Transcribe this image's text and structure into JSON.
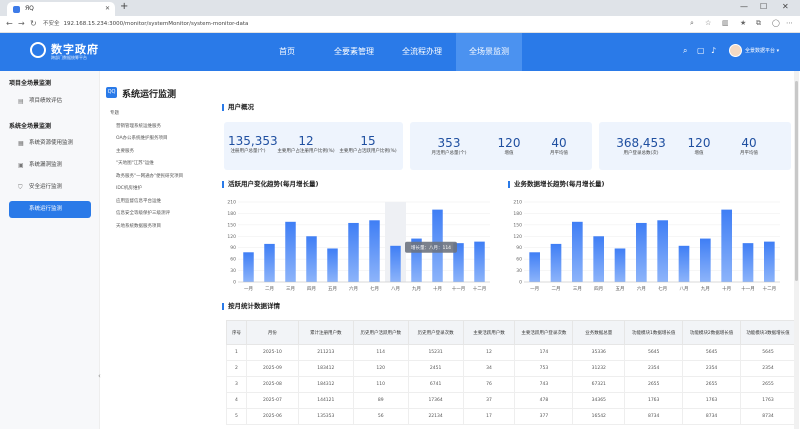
{
  "browser": {
    "tab_title": "ЯQ",
    "url_warning": "不安全",
    "url": "192.168.15.234:3000/monitor/systemMonitor/system-monitor-data"
  },
  "header": {
    "logo_title": "数字政府",
    "logo_sub": "跨部门数据统筹平台",
    "menu": [
      "首页",
      "全要素管理",
      "全流程办理",
      "全场景监测"
    ],
    "active_menu": 3,
    "user": "全景数据平台 ▾"
  },
  "sidebar": {
    "groups": [
      {
        "title": "项目全场景监测",
        "items": [
          {
            "label": "项目绩效评估",
            "icon": "doc-icon"
          }
        ]
      },
      {
        "title": "系统全场景监测",
        "items": [
          {
            "label": "系统资源使用监测",
            "icon": "server-icon"
          },
          {
            "label": "系统漏洞监测",
            "icon": "bug-icon"
          },
          {
            "label": "安全运行监测",
            "icon": "shield-icon"
          },
          {
            "label": "系统运行监测",
            "icon": "monitor-icon",
            "active": true
          }
        ]
      }
    ]
  },
  "page": {
    "title": "系统运行监测",
    "title_icon": "QQ"
  },
  "tree": {
    "items": [
      "专题",
      "营销管理系统运维服务",
      "OA办公系统维护服务项目",
      "主要服务",
      "\"天地图\"江苏\"运维",
      "政务服务\"一网通办\"便民研究项目",
      "IDC机房维护",
      "应用监督信息平台运维",
      "信息安全等级保护三级测评",
      "天地系统数据服务项目"
    ]
  },
  "overview": {
    "title": "用户概况",
    "cards": [
      [
        {
          "v": "135,353",
          "l": "注册用户总量(个)"
        },
        {
          "v": "12",
          "l": "主要用户占注册用户比例(%)"
        },
        {
          "v": "15",
          "l": "主要用户占活跃用户比例(%)"
        }
      ],
      [
        {
          "v": "353",
          "l": "月活用户总量(个)"
        },
        {
          "v": "120",
          "l": "增值"
        },
        {
          "v": "40",
          "l": "月平均值"
        }
      ],
      [
        {
          "v": "368,453",
          "l": "用户登录总数(次)"
        },
        {
          "v": "120",
          "l": "增值"
        },
        {
          "v": "40",
          "l": "月平均值"
        }
      ]
    ]
  },
  "chart_data": [
    {
      "type": "bar",
      "title": "活跃用户变化趋势(每月增长量)",
      "categories": [
        "一月",
        "二月",
        "三月",
        "四月",
        "五月",
        "六月",
        "七月",
        "八月",
        "九月",
        "十月",
        "十一月",
        "十二月"
      ],
      "values": [
        78,
        100,
        158,
        120,
        88,
        155,
        162,
        95,
        114,
        190,
        102,
        106
      ],
      "ylim": [
        0,
        210
      ],
      "yticks": [
        0,
        30,
        60,
        90,
        120,
        150,
        180,
        210
      ],
      "tooltip": "增长量：八月：114",
      "tooltip_index": 7
    },
    {
      "type": "bar",
      "title": "业务数据增长趋势(每月增长量)",
      "categories": [
        "一月",
        "二月",
        "三月",
        "四月",
        "五月",
        "六月",
        "七月",
        "八月",
        "九月",
        "十月",
        "十一月",
        "十二月"
      ],
      "values": [
        78,
        100,
        158,
        120,
        88,
        155,
        162,
        95,
        114,
        190,
        102,
        106
      ],
      "ylim": [
        0,
        210
      ],
      "yticks": [
        0,
        30,
        60,
        90,
        120,
        150,
        180,
        210
      ]
    }
  ],
  "table": {
    "title": "按月统计数据详情",
    "headers": [
      "序号",
      "月份",
      "累计注册用户数",
      "历史用户活跃用户数",
      "历史用户登录次数",
      "主要活跃用户数",
      "主要活跃用户登录次数",
      "业务数据总量",
      "功能模块1数据增长值",
      "功能模块2数据增长值",
      "功能模块3数据增长值"
    ],
    "rows": [
      [
        "1",
        "2025-10",
        "211213",
        "114",
        "15231",
        "12",
        "174",
        "35336",
        "5645",
        "5645",
        "5645"
      ],
      [
        "2",
        "2025-09",
        "183412",
        "120",
        "2451",
        "34",
        "753",
        "31232",
        "2354",
        "2354",
        "2354"
      ],
      [
        "3",
        "2025-08",
        "184312",
        "110",
        "6741",
        "76",
        "743",
        "67321",
        "2655",
        "2655",
        "2655"
      ],
      [
        "4",
        "2025-07",
        "144121",
        "89",
        "17364",
        "37",
        "478",
        "34365",
        "1763",
        "1763",
        "1763"
      ],
      [
        "5",
        "2025-06",
        "135353",
        "56",
        "22134",
        "17",
        "377",
        "16542",
        "8734",
        "8734",
        "8734"
      ]
    ]
  }
}
